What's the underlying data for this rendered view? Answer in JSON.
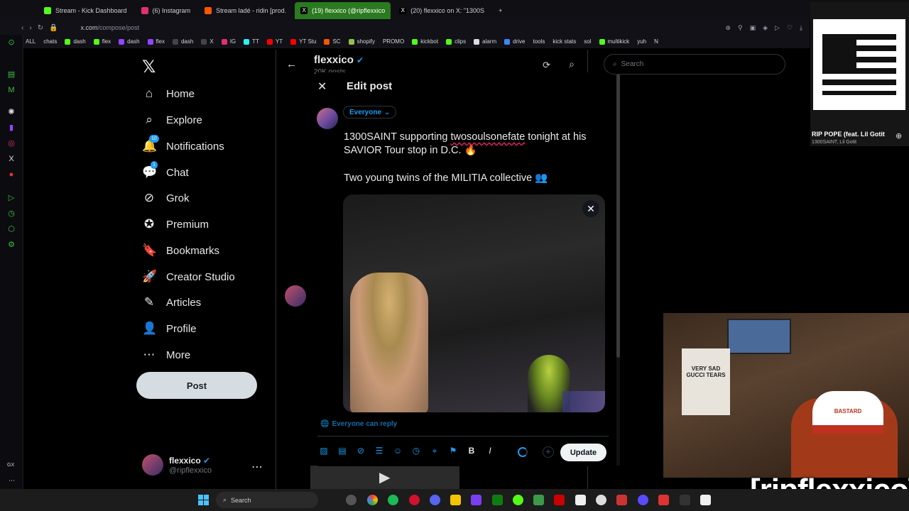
{
  "browser": {
    "tabs": [
      {
        "label": "Stream - Kick Dashboard",
        "color": "#53fc18"
      },
      {
        "label": "(6) Instagram",
        "color": "#e1306c"
      },
      {
        "label": "Stream ladé - ridin [prod.",
        "color": "#ff5500"
      },
      {
        "label": "(19) flexxico (@ripflexxico",
        "color": "#ffffff"
      },
      {
        "label": "(20) flexxico on X: \"1300S",
        "color": "#ffffff"
      }
    ],
    "url_host": "x.com",
    "url_path": "/compose/post",
    "bookmarks": [
      "ALL",
      "chats",
      "dash",
      "flex",
      "dash",
      "flex",
      "dash",
      "X",
      "IG",
      "TT",
      "YT",
      "YT Stu",
      "SC",
      "shopify",
      "PROMO",
      "kickbot",
      "clips",
      "alarm",
      "drive",
      "tools",
      "kick stats",
      "sol",
      "multikick",
      "yuh",
      "N"
    ],
    "side_badges": [
      "GX"
    ]
  },
  "nav": {
    "items": [
      {
        "label": "Home",
        "icon": "home-icon",
        "glyph": "⌂"
      },
      {
        "label": "Explore",
        "icon": "search-icon",
        "glyph": "⌕"
      },
      {
        "label": "Notifications",
        "icon": "bell-icon",
        "glyph": "🔔"
      },
      {
        "label": "Chat",
        "icon": "chat-icon",
        "glyph": "💬"
      },
      {
        "label": "Grok",
        "icon": "grok-icon",
        "glyph": "⊘"
      },
      {
        "label": "Premium",
        "icon": "premium-icon",
        "glyph": "✪"
      },
      {
        "label": "Bookmarks",
        "icon": "bookmark-icon",
        "glyph": "🔖"
      },
      {
        "label": "Creator Studio",
        "icon": "rocket-icon",
        "glyph": "🚀"
      },
      {
        "label": "Articles",
        "icon": "article-icon",
        "glyph": "✎"
      },
      {
        "label": "Profile",
        "icon": "person-icon",
        "glyph": "👤"
      },
      {
        "label": "More",
        "icon": "more-icon",
        "glyph": "⋯"
      }
    ],
    "notif_badge": "10",
    "chat_badge": "1",
    "post_label": "Post",
    "account": {
      "name": "flexxico",
      "handle": "@ripflexxico"
    }
  },
  "timeline": {
    "name": "flexxico",
    "sub": "20K posts"
  },
  "search": {
    "placeholder": "Search"
  },
  "modal": {
    "title": "Edit post",
    "audience": "Everyone",
    "line1": "1300SAINT supporting ",
    "mention": "twosoulsonefate",
    "line1b": " tonight at his SAVIOR Tour stop in D.C. 🔥",
    "line2": "Two young twins of the MILITIA collective 👥",
    "reply_setting": "Everyone can reply",
    "update_label": "Update"
  },
  "music": {
    "title": "RIP POPE (feat. Lil Gotit",
    "artist": "1300SAINT, Lil Gotit"
  },
  "webcam": {
    "shirt_text": "VERY SAD GUCCI TEARS",
    "hat_text": "BASTARD"
  },
  "overlay_name": "[ripflexxico]",
  "taskbar": {
    "search": "Search"
  }
}
